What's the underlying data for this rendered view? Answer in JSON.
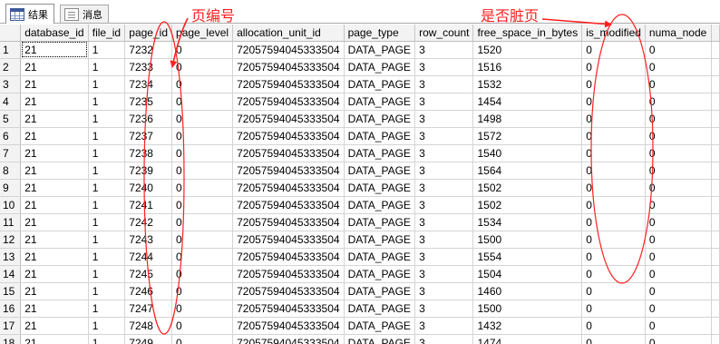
{
  "tabs": [
    {
      "label": "结果",
      "icon": "grid-results-icon",
      "active": true
    },
    {
      "label": "消息",
      "icon": "messages-icon",
      "active": false
    }
  ],
  "grid": {
    "columns": [
      "database_id",
      "file_id",
      "page_id",
      "page_level",
      "allocation_unit_id",
      "page_type",
      "row_count",
      "free_space_in_bytes",
      "is_modified",
      "numa_node"
    ],
    "rows": [
      {
        "num": "1",
        "cells": [
          "21",
          "1",
          "7232",
          "0",
          "72057594045333504",
          "DATA_PAGE",
          "3",
          "1520",
          "0",
          "0"
        ]
      },
      {
        "num": "2",
        "cells": [
          "21",
          "1",
          "7233",
          "0",
          "72057594045333504",
          "DATA_PAGE",
          "3",
          "1516",
          "0",
          "0"
        ]
      },
      {
        "num": "3",
        "cells": [
          "21",
          "1",
          "7234",
          "0",
          "72057594045333504",
          "DATA_PAGE",
          "3",
          "1532",
          "0",
          "0"
        ]
      },
      {
        "num": "4",
        "cells": [
          "21",
          "1",
          "7235",
          "0",
          "72057594045333504",
          "DATA_PAGE",
          "3",
          "1454",
          "0",
          "0"
        ]
      },
      {
        "num": "5",
        "cells": [
          "21",
          "1",
          "7236",
          "0",
          "72057594045333504",
          "DATA_PAGE",
          "3",
          "1498",
          "0",
          "0"
        ]
      },
      {
        "num": "6",
        "cells": [
          "21",
          "1",
          "7237",
          "0",
          "72057594045333504",
          "DATA_PAGE",
          "3",
          "1572",
          "0",
          "0"
        ]
      },
      {
        "num": "7",
        "cells": [
          "21",
          "1",
          "7238",
          "0",
          "72057594045333504",
          "DATA_PAGE",
          "3",
          "1540",
          "0",
          "0"
        ]
      },
      {
        "num": "8",
        "cells": [
          "21",
          "1",
          "7239",
          "0",
          "72057594045333504",
          "DATA_PAGE",
          "3",
          "1564",
          "0",
          "0"
        ]
      },
      {
        "num": "9",
        "cells": [
          "21",
          "1",
          "7240",
          "0",
          "72057594045333504",
          "DATA_PAGE",
          "3",
          "1502",
          "0",
          "0"
        ]
      },
      {
        "num": "10",
        "cells": [
          "21",
          "1",
          "7241",
          "0",
          "72057594045333504",
          "DATA_PAGE",
          "3",
          "1502",
          "0",
          "0"
        ]
      },
      {
        "num": "11",
        "cells": [
          "21",
          "1",
          "7242",
          "0",
          "72057594045333504",
          "DATA_PAGE",
          "3",
          "1534",
          "0",
          "0"
        ]
      },
      {
        "num": "12",
        "cells": [
          "21",
          "1",
          "7243",
          "0",
          "72057594045333504",
          "DATA_PAGE",
          "3",
          "1500",
          "0",
          "0"
        ]
      },
      {
        "num": "13",
        "cells": [
          "21",
          "1",
          "7244",
          "0",
          "72057594045333504",
          "DATA_PAGE",
          "3",
          "1554",
          "0",
          "0"
        ]
      },
      {
        "num": "14",
        "cells": [
          "21",
          "1",
          "7245",
          "0",
          "72057594045333504",
          "DATA_PAGE",
          "3",
          "1504",
          "0",
          "0"
        ]
      },
      {
        "num": "15",
        "cells": [
          "21",
          "1",
          "7246",
          "0",
          "72057594045333504",
          "DATA_PAGE",
          "3",
          "1460",
          "0",
          "0"
        ]
      },
      {
        "num": "16",
        "cells": [
          "21",
          "1",
          "7247",
          "0",
          "72057594045333504",
          "DATA_PAGE",
          "3",
          "1500",
          "0",
          "0"
        ]
      },
      {
        "num": "17",
        "cells": [
          "21",
          "1",
          "7248",
          "0",
          "72057594045333504",
          "DATA_PAGE",
          "3",
          "1432",
          "0",
          "0"
        ]
      },
      {
        "num": "18",
        "cells": [
          "21",
          "1",
          "7249",
          "0",
          "72057594045333504",
          "DATA_PAGE",
          "3",
          "1474",
          "0",
          "0"
        ]
      }
    ]
  },
  "annotations": {
    "page_number": "页编号",
    "dirty_page": "是否脏页",
    "color": "#ff2020"
  }
}
